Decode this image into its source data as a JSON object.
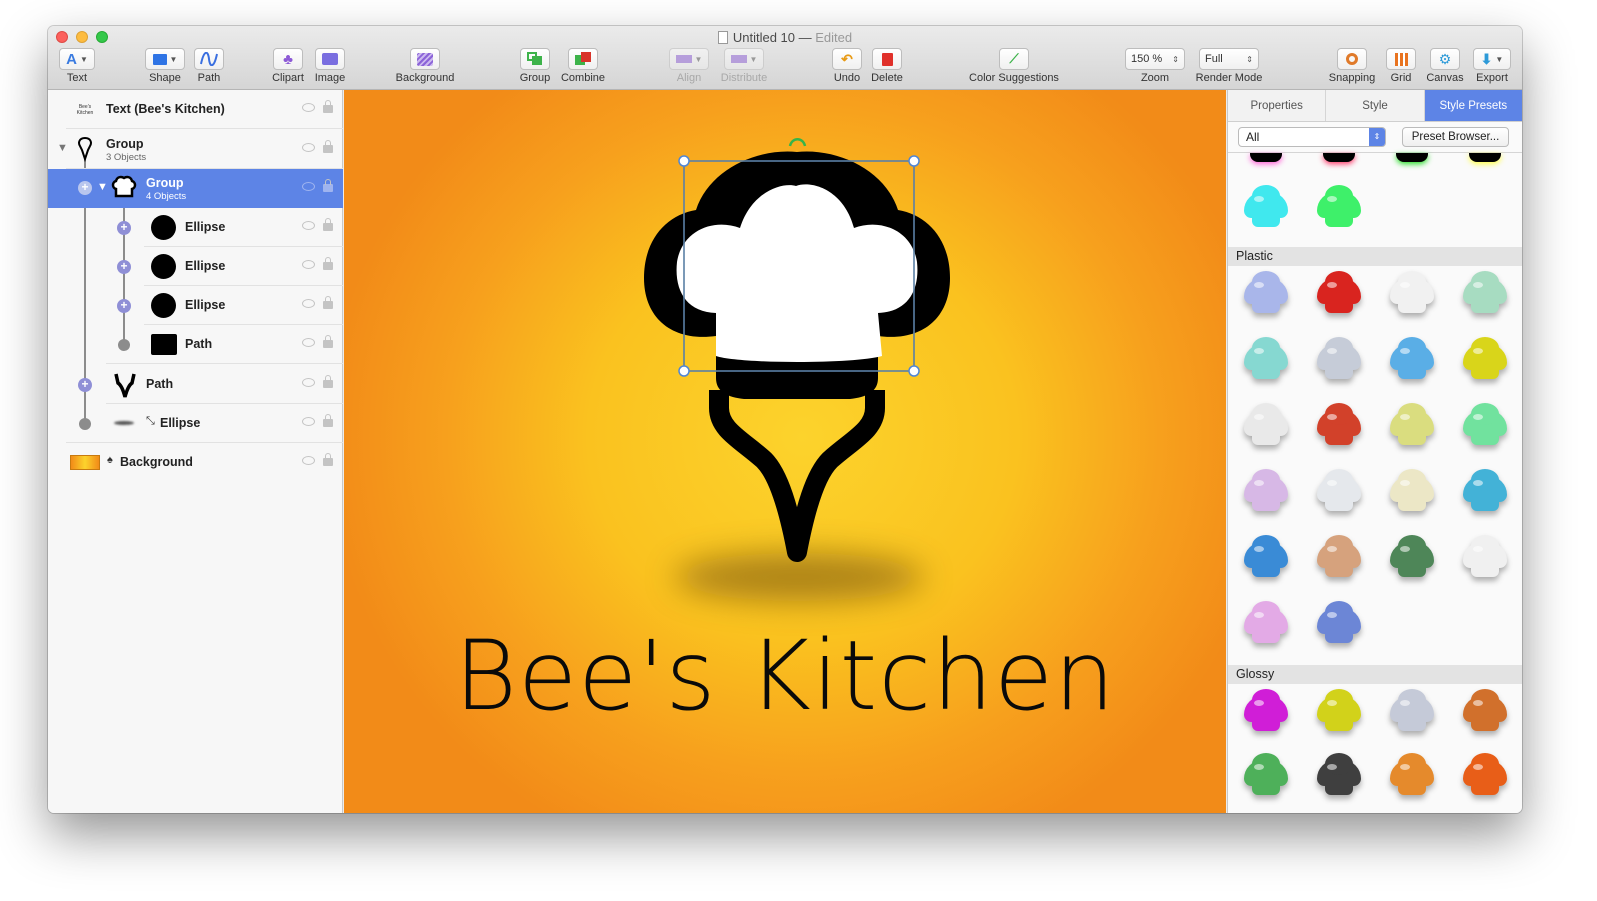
{
  "window": {
    "title": "Untitled 10",
    "edited": "Edited"
  },
  "toolbar": {
    "text_label": "Text",
    "shape_label": "Shape",
    "path_label": "Path",
    "clipart_label": "Clipart",
    "image_label": "Image",
    "background_label": "Background",
    "group_label": "Group",
    "combine_label": "Combine",
    "align_label": "Align",
    "distribute_label": "Distribute",
    "undo_label": "Undo",
    "delete_label": "Delete",
    "color_suggestions_label": "Color Suggestions",
    "zoom_value": "150 %",
    "zoom_label": "Zoom",
    "render_mode_value": "Full",
    "render_mode_label": "Render Mode",
    "snapping_label": "Snapping",
    "grid_label": "Grid",
    "canvas_label": "Canvas",
    "export_label": "Export",
    "text_icon_glyph": "A"
  },
  "layers": [
    {
      "name": "Text (Bee's Kitchen)",
      "sub": ""
    },
    {
      "name": "Group",
      "sub": "3 Objects"
    },
    {
      "name": "Group",
      "sub": "4 Objects"
    },
    {
      "name": "Ellipse",
      "sub": ""
    },
    {
      "name": "Ellipse",
      "sub": ""
    },
    {
      "name": "Ellipse",
      "sub": ""
    },
    {
      "name": "Path",
      "sub": ""
    },
    {
      "name": "Path",
      "sub": ""
    },
    {
      "name": "Ellipse",
      "sub": ""
    },
    {
      "name": "Background",
      "sub": ""
    }
  ],
  "layer_thumb_text": "Bee's Kitchen",
  "canvas": {
    "brand_text": "Bee's Kitchen"
  },
  "right_panel": {
    "tabs": [
      "Properties",
      "Style",
      "Style Presets"
    ],
    "active_tab": "Style Presets",
    "filter_value": "All",
    "preset_browser_label": "Preset Browser...",
    "sections": [
      "Plastic",
      "Glossy"
    ]
  },
  "presets": {
    "top_colors": [
      "#ff5cd6",
      "#ff3366",
      "#20dd20",
      "#ffff40"
    ],
    "top_row2": [
      "#40e8ee",
      "#3ef06a"
    ],
    "plastic": [
      "#a9b6ea",
      "#d9241f",
      "#f1f1f1",
      "#a7dcc1",
      "#86d8d1",
      "#c6ccd8",
      "#5aaee6",
      "#d9d51a",
      "#e9e9e9",
      "#d2412a",
      "#dadd7f",
      "#71e29e",
      "#d7b8e6",
      "#e5e8ec",
      "#ece7c6",
      "#43b2d7",
      "#3a8bd6",
      "#d6a27d",
      "#4e8658",
      "#f0f0f0",
      "#e3aae6",
      "#6c86d6"
    ],
    "glossy": [
      "#d01ed7",
      "#d2d21a",
      "#c5cad8",
      "#d1702c",
      "#4eb05a",
      "#3f3f3f",
      "#e58a2c",
      "#e85e18"
    ]
  },
  "colors": {
    "accent": "#5d84e6",
    "canvas_center": "#fcd32c",
    "canvas_edge": "#f28b18"
  }
}
